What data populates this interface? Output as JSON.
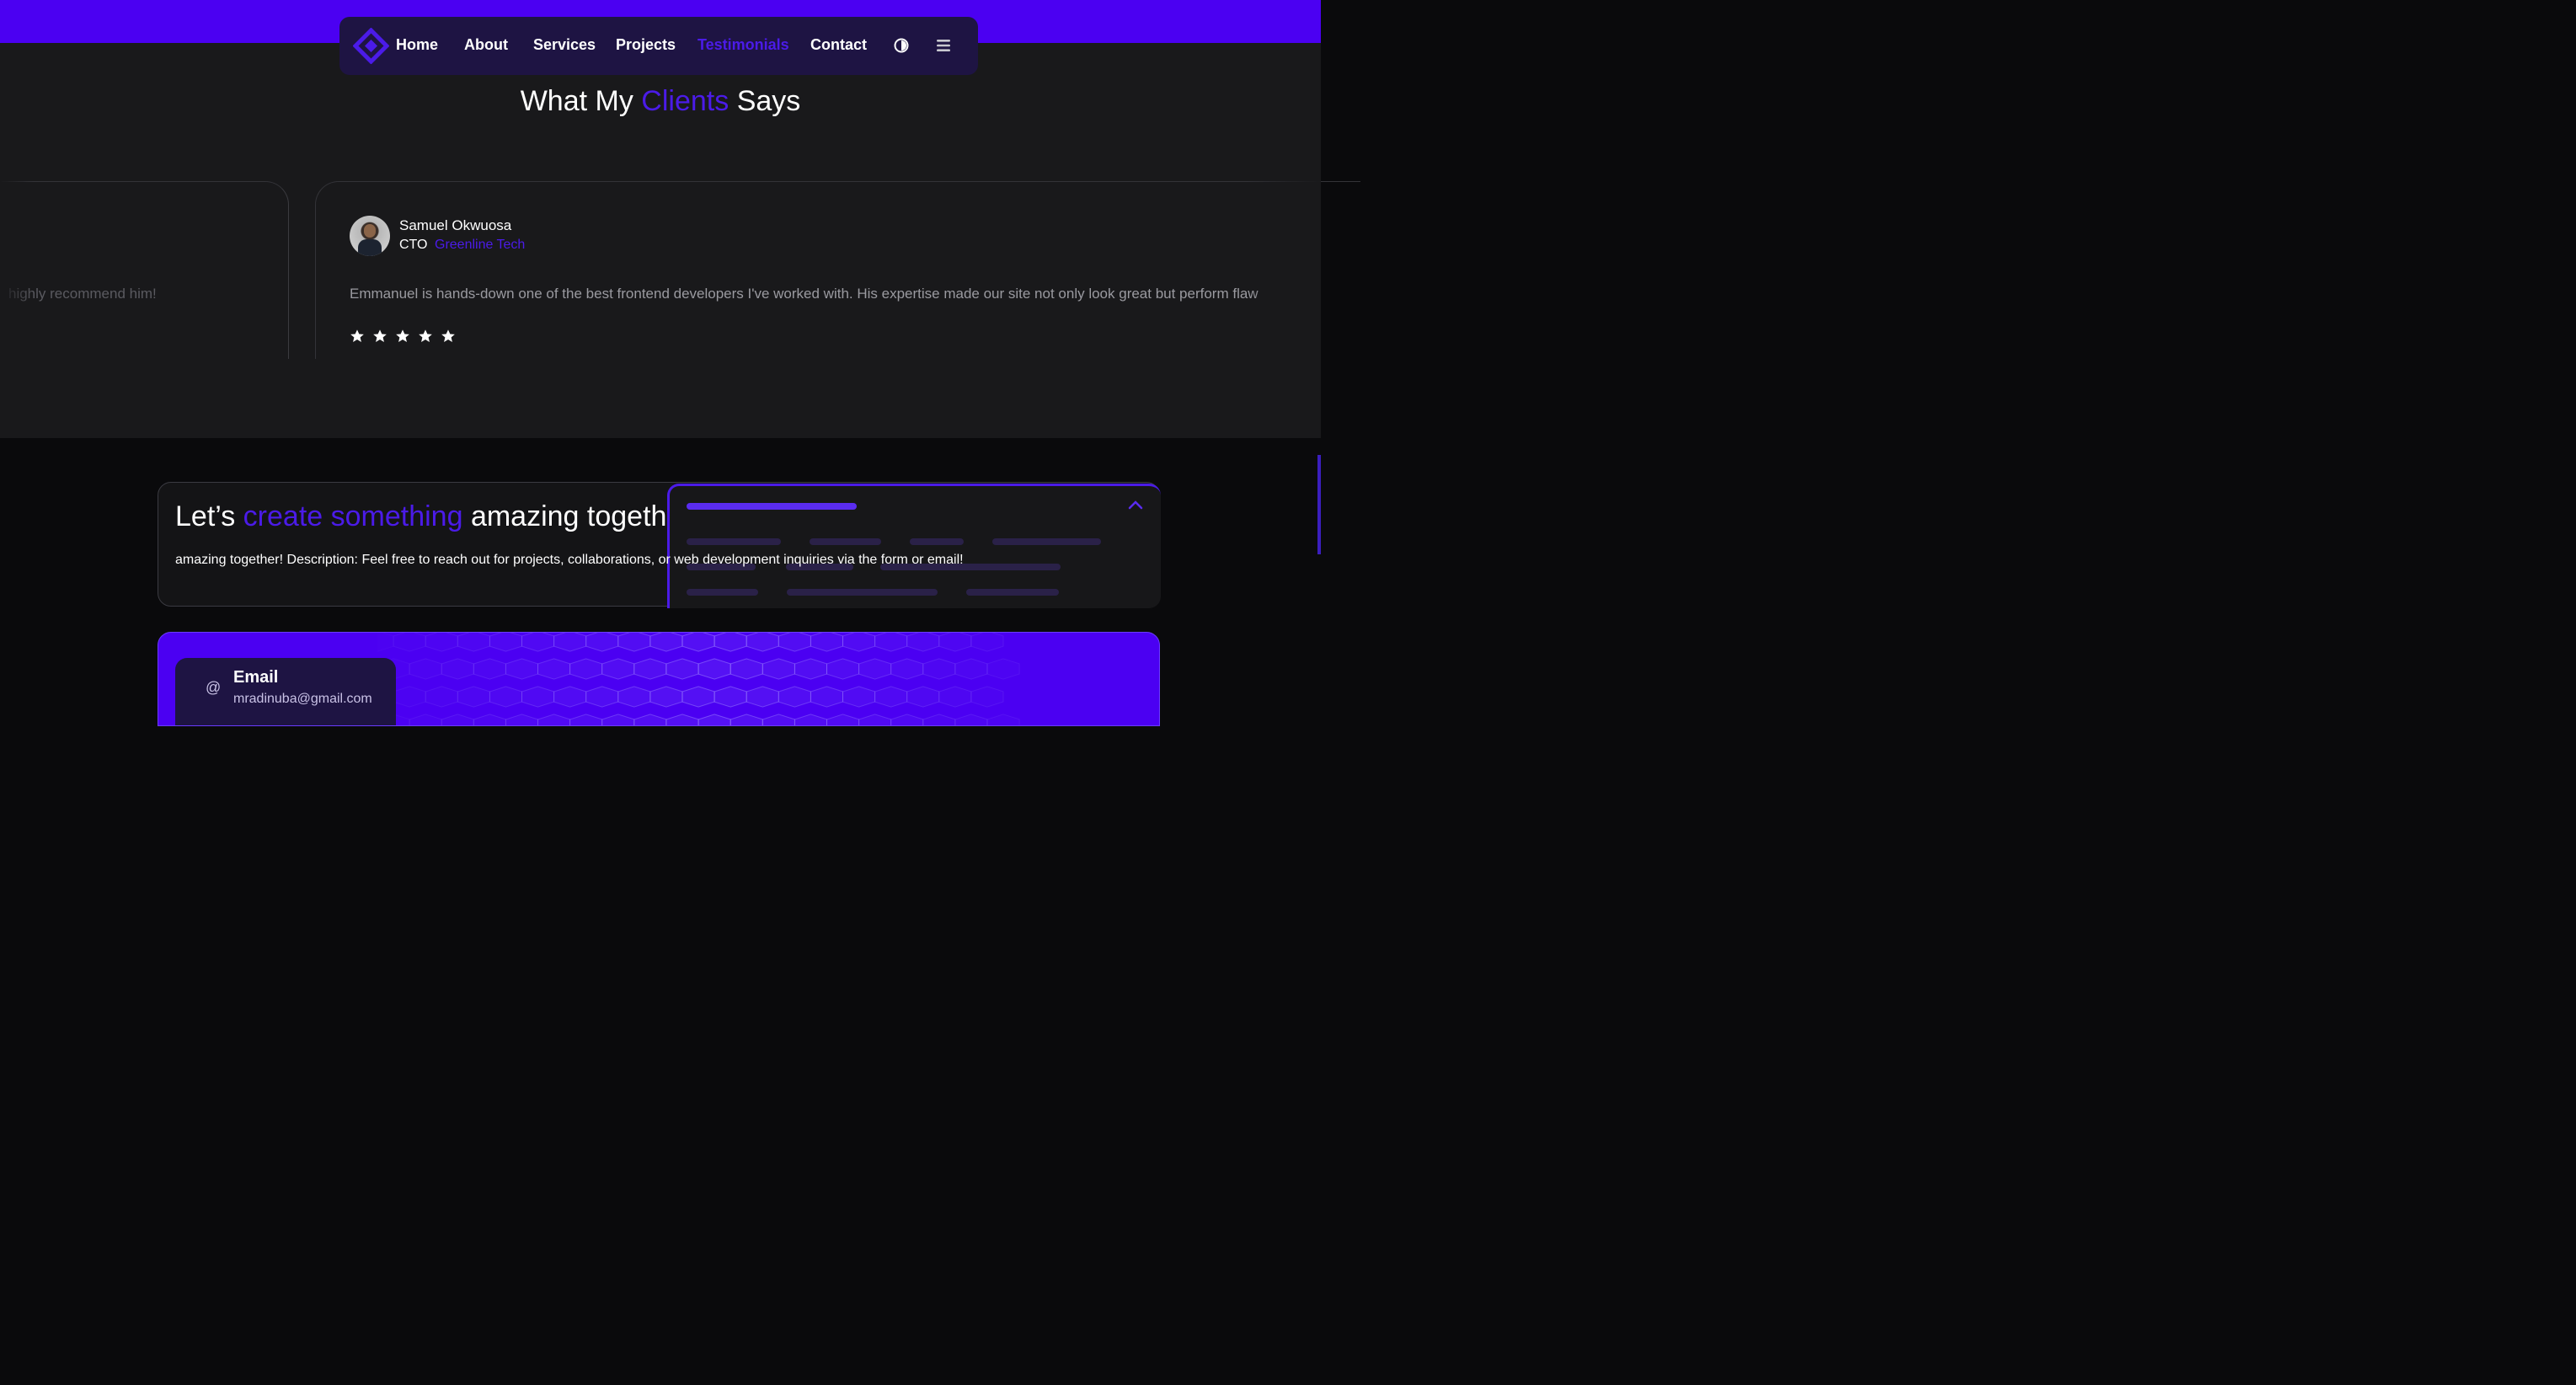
{
  "nav": {
    "links": [
      "Home",
      "About",
      "Services",
      "Projects",
      "Testimonials",
      "Contact"
    ],
    "active": "Testimonials"
  },
  "testimonials": {
    "heading_pre": "What My",
    "heading_accent": "Clients",
    "heading_post": "Says",
    "prev_quote_tail": "highly recommend him!",
    "current": {
      "name": "Samuel Okwuosa",
      "role": "CTO",
      "company": "Greenline Tech",
      "quote": "Emmanuel is hands-down one of the best frontend developers I've worked with. His expertise made our site not only look great but perform flaw",
      "rating": 5
    }
  },
  "cta": {
    "title_pre": "Let’s",
    "title_accent": "create something",
    "title_post": "amazing together!",
    "description": "amazing together! Description: Feel free to reach out for projects, collaborations, or web development inquiries via the form or email!"
  },
  "contact": {
    "email_label": "Email",
    "email_value": "mradinuba@gmail.com"
  },
  "colors": {
    "accent": "#4b1be8",
    "brand_purple": "#4b00f2",
    "nav_bg": "#1e1443"
  },
  "icons": [
    "logo-icon",
    "theme-toggle-icon",
    "menu-icon",
    "star-icon",
    "chevron-up-icon",
    "at-icon"
  ]
}
